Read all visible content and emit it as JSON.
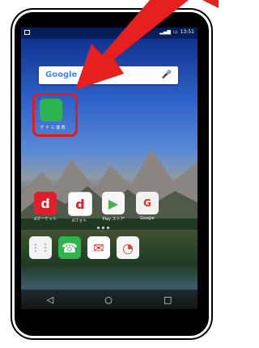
{
  "screen": {
    "status_bar": {
      "right_text": "13:51"
    },
    "search": {
      "logo": "Google",
      "mic_icon": "mic-icon"
    },
    "highlighted_app": {
      "label": "デ ナ 三 連 携"
    },
    "apps": [
      {
        "label": "dマーケット"
      },
      {
        "label": "dフォト"
      },
      {
        "label": "Play ストア"
      },
      {
        "label": "Google"
      }
    ],
    "dock": [
      {
        "label": "apps"
      },
      {
        "label": "phone"
      },
      {
        "label": "mail"
      },
      {
        "label": "chrome"
      }
    ]
  }
}
